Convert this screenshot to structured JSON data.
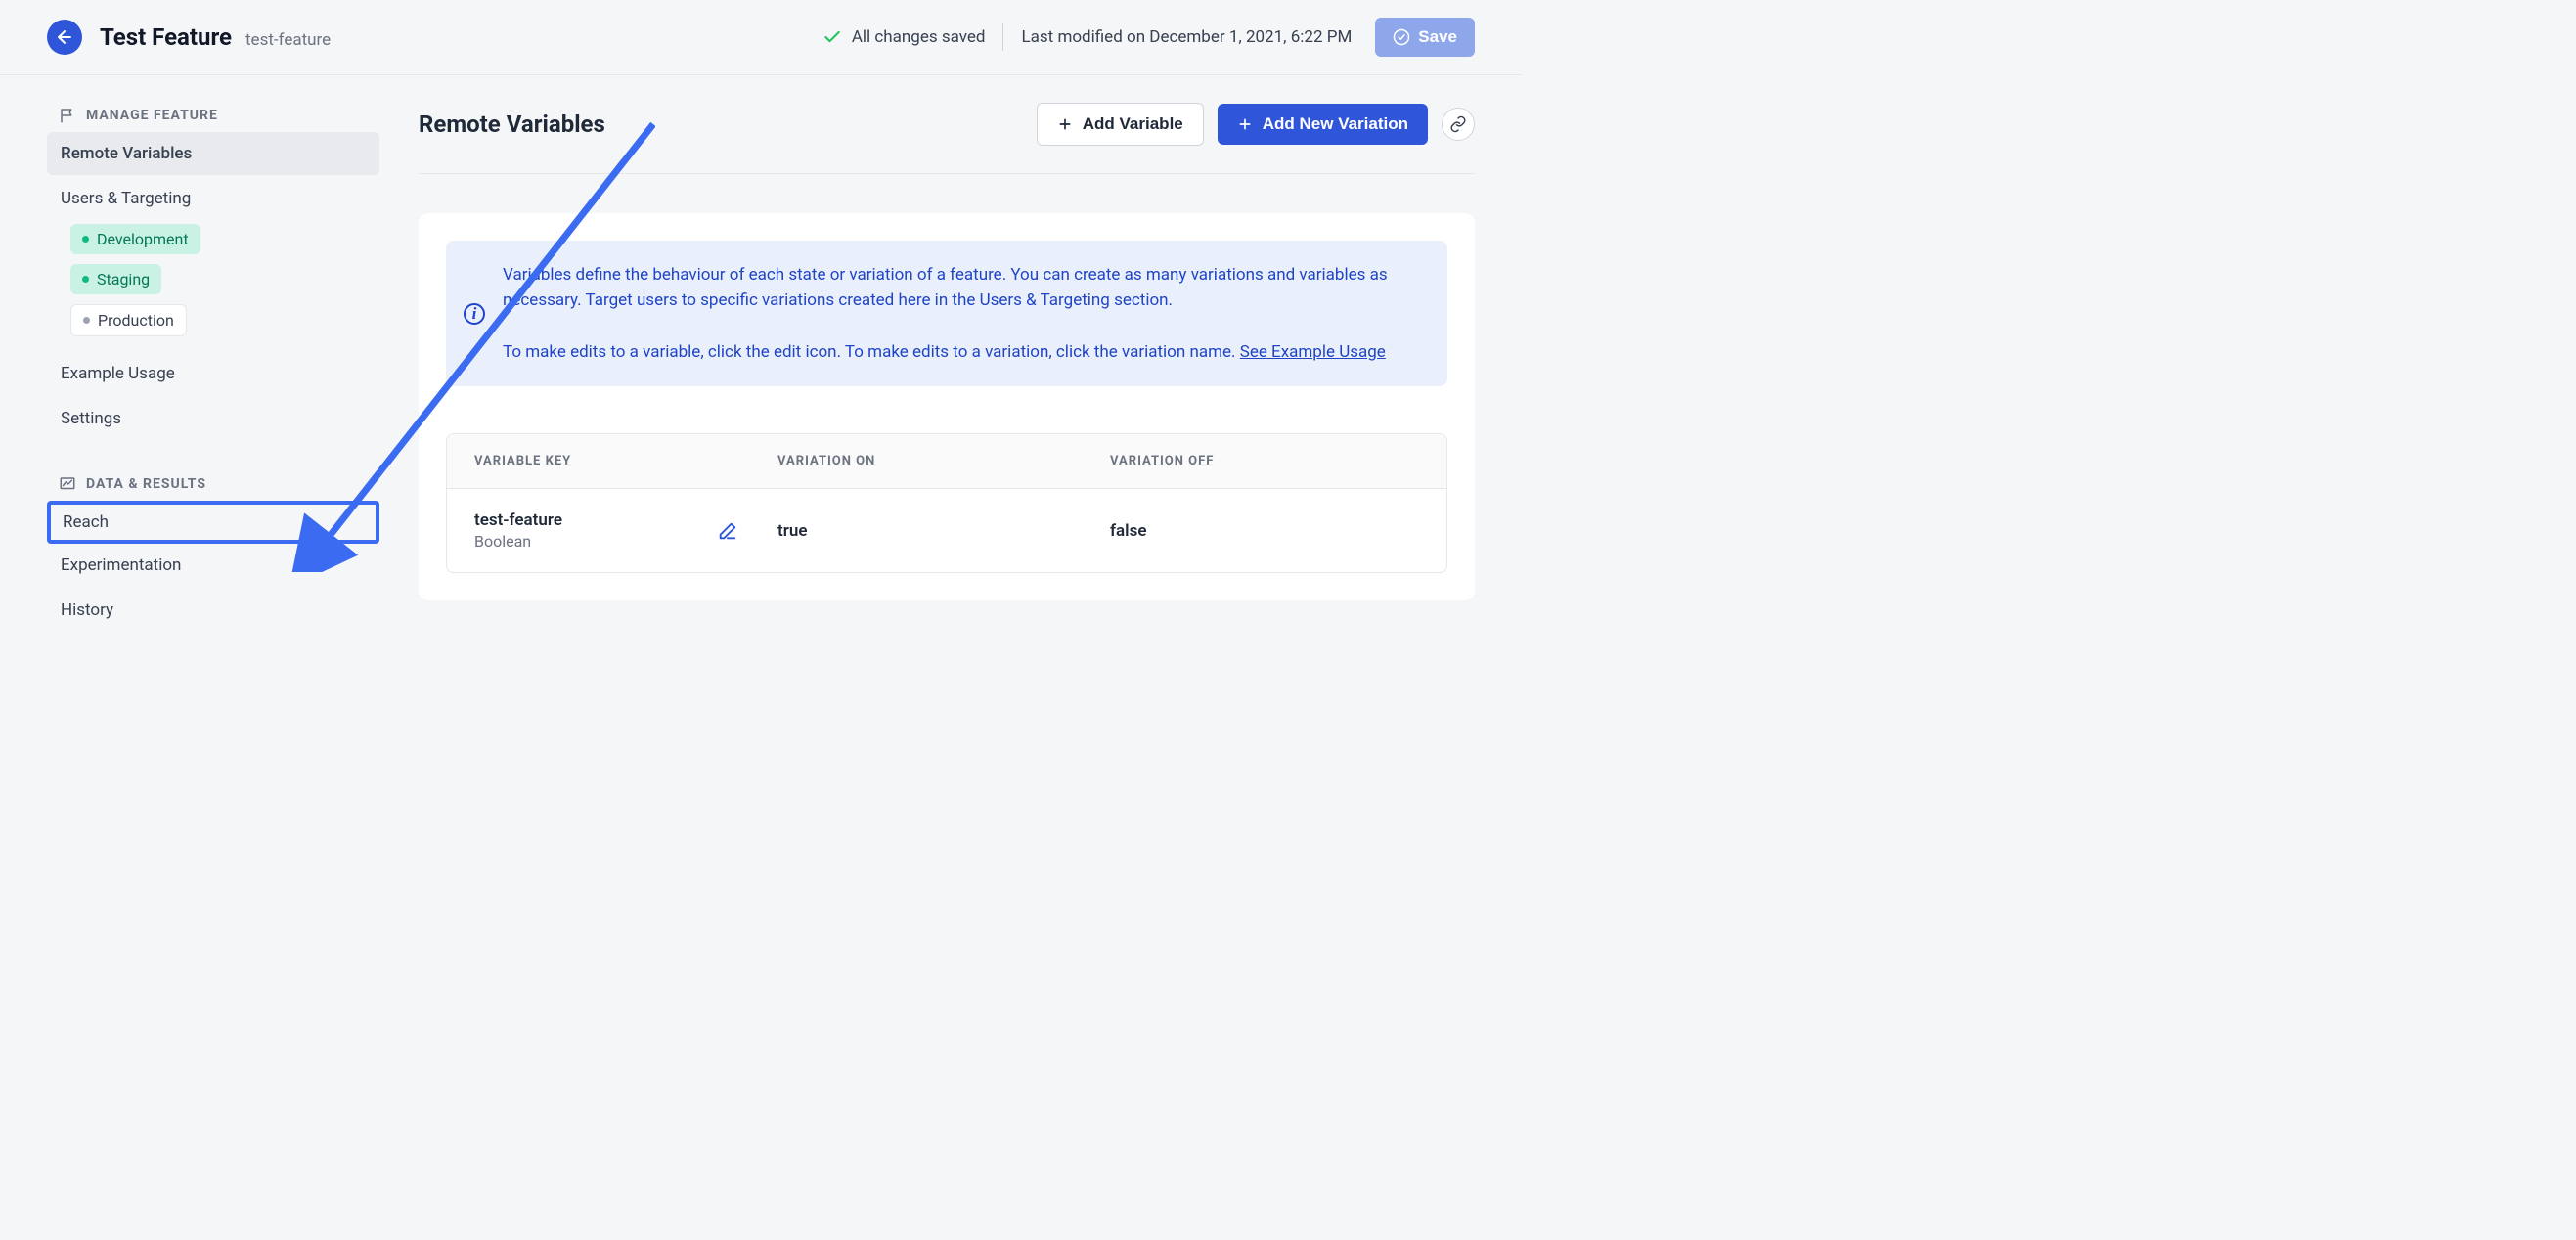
{
  "header": {
    "title": "Test Feature",
    "slug": "test-feature",
    "saved_status": "All changes saved",
    "last_modified": "Last modified on December 1, 2021, 6:22 PM",
    "save_label": "Save"
  },
  "sidebar": {
    "section_manage": "Manage Feature",
    "section_data": "Data & Results",
    "items": {
      "remote_variables": "Remote Variables",
      "users_targeting": "Users & Targeting",
      "example_usage": "Example Usage",
      "settings": "Settings",
      "reach": "Reach",
      "experimentation": "Experimentation",
      "history": "History"
    },
    "environments": {
      "development": "Development",
      "staging": "Staging",
      "production": "Production"
    }
  },
  "main": {
    "title": "Remote Variables",
    "add_variable": "Add Variable",
    "add_variation": "Add New Variation",
    "info_p1": "Variables define the behaviour of each state or variation of a feature. You can create as many variations and variables as necessary. Target users to specific variations created here in the Users & Targeting section.",
    "info_p2_prefix": "To make edits to a variable, click the edit icon. To make edits to a variation, click the variation name. ",
    "info_link": "See Example Usage",
    "table": {
      "col_key": "Variable Key",
      "col_on": "Variation On",
      "col_off": "Variation Off",
      "row": {
        "key": "test-feature",
        "type": "Boolean",
        "on_value": "true",
        "off_value": "false"
      }
    }
  }
}
